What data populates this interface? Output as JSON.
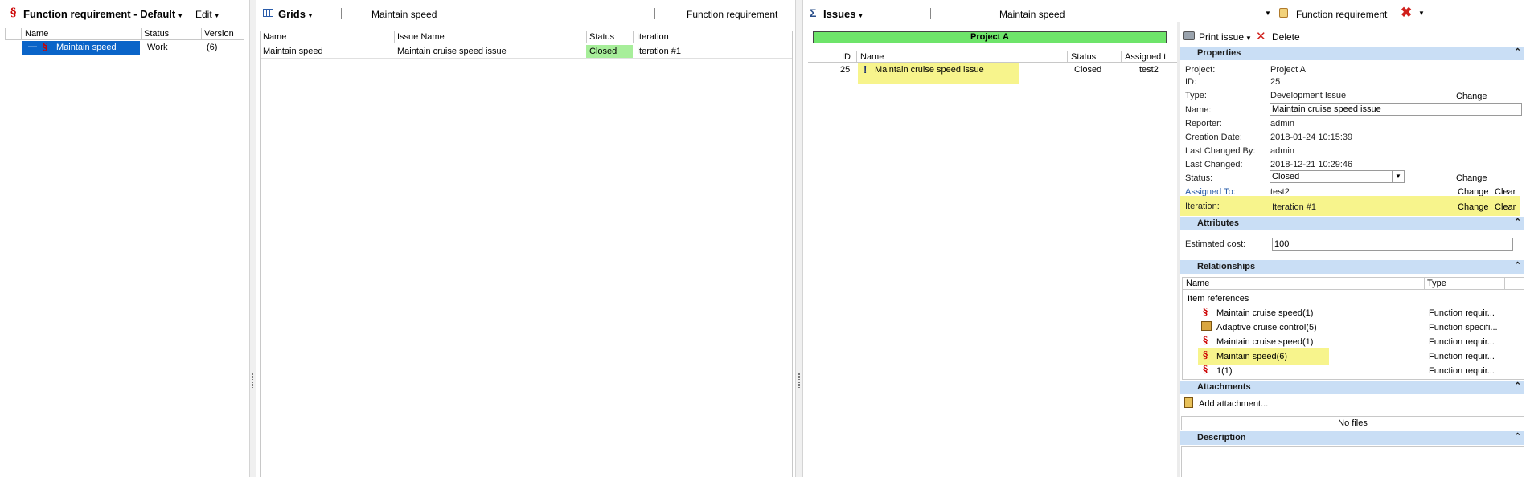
{
  "left": {
    "title": "Function requirement - Default",
    "title_a": "Function requirement",
    "title_b": "- Default",
    "edit_menu": "Edit",
    "columns": [
      "Name",
      "Status",
      "Version"
    ],
    "row": {
      "name": "Maintain speed",
      "status": "Work",
      "version": "(6)"
    }
  },
  "grids": {
    "menu": "Grids",
    "context": "Maintain speed",
    "type": "Function requirement",
    "columns": [
      "Name",
      "Issue Name",
      "Status",
      "Iteration"
    ],
    "row": {
      "name": "Maintain speed",
      "issue_name": "Maintain cruise speed issue",
      "status": "Closed",
      "iteration": "Iteration #1"
    }
  },
  "issues": {
    "menu": "Issues",
    "context": "Maintain speed",
    "type": "Function requirement",
    "project_bar": "Project A",
    "columns": [
      "ID",
      "Name",
      "Status",
      "Assigned t"
    ],
    "row": {
      "id": "25",
      "name": "Maintain cruise speed issue",
      "status": "Closed",
      "assigned": "test2"
    }
  },
  "details": {
    "print_issue": "Print issue",
    "delete": "Delete",
    "properties_header": "Properties",
    "props": {
      "project_label": "Project:",
      "project": "Project A",
      "id_label": "ID:",
      "id": "25",
      "type_label": "Type:",
      "type": "Development Issue",
      "name_label": "Name:",
      "name": "Maintain cruise speed issue",
      "reporter_label": "Reporter:",
      "reporter": "admin",
      "created_label": "Creation Date:",
      "created": "2018-01-24 10:15:39",
      "changed_by_label": "Last Changed By:",
      "changed_by": "admin",
      "changed_label": "Last Changed:",
      "changed": "2018-12-21 10:29:46",
      "status_label": "Status:",
      "status": "Closed",
      "assigned_label": "Assigned To:",
      "assigned": "test2",
      "iteration_label": "Iteration:",
      "iteration": "Iteration #1"
    },
    "change": "Change",
    "clear": "Clear",
    "attributes_header": "Attributes",
    "estimated_cost_label": "Estimated cost:",
    "estimated_cost": "100",
    "relationships_header": "Relationships",
    "rel_columns": [
      "Name",
      "Type"
    ],
    "item_references": "Item references",
    "relations": [
      {
        "name": "Maintain cruise speed(1)",
        "type": "Function requir..."
      },
      {
        "name": "Adaptive cruise control(5)",
        "type": "Function specifi..."
      },
      {
        "name": "Maintain cruise speed(1)",
        "type": "Function requir..."
      },
      {
        "name": "Maintain speed(6)",
        "type": "Function requir..."
      },
      {
        "name": "1(1)",
        "type": "Function requir..."
      }
    ],
    "attachments_header": "Attachments",
    "add_attachment": "Add attachment...",
    "no_files": "No files",
    "description_header": "Description"
  }
}
